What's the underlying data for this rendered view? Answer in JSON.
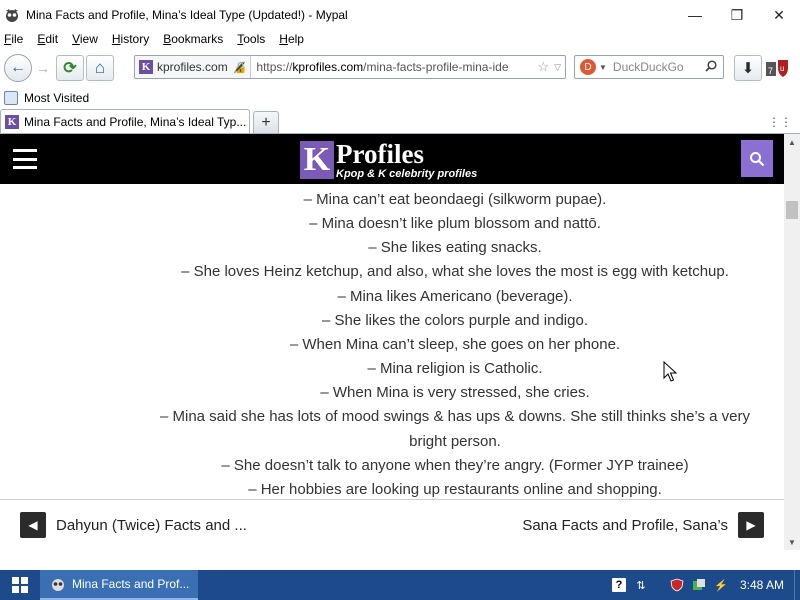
{
  "window": {
    "title": "Mina Facts and Profile, Mina’s Ideal Type (Updated!) - Mypal",
    "minimize": "—",
    "maximize": "❐",
    "close": "✕"
  },
  "menu": {
    "items": [
      "File",
      "Edit",
      "View",
      "History",
      "Bookmarks",
      "Tools",
      "Help"
    ]
  },
  "toolbar": {
    "back": "←",
    "forward": "→",
    "reload": "⟳",
    "home": "⌂",
    "identity_domain": "kprofiles.com",
    "url_prefix": "https://",
    "url_host": "kprofiles.com",
    "url_path": "/mina-facts-profile-mina-ide",
    "search_placeholder": "DuckDuckGo",
    "download": "⬇"
  },
  "bookmarks": {
    "items": [
      "Most Visited"
    ]
  },
  "tabs": {
    "active_title": "Mina Facts and Profile, Mina’s Ideal Typ...",
    "new_tab": "+"
  },
  "site": {
    "logo_letter": "K",
    "logo_name": "Profiles",
    "logo_tagline": "Kpop & K celebrity profiles"
  },
  "facts": [
    "– Mina can’t eat beondaegi (silkworm pupae).",
    "– Mina doesn’t like plum blossom and nattō.",
    "– She likes eating snacks.",
    "– She loves Heinz ketchup, and also, what she loves the most is egg with ketchup.",
    "– Mina likes Americano (beverage).",
    "– She likes the colors purple and indigo.",
    "– When Mina can’t sleep, she goes on her phone.",
    "– Mina religion is Catholic.",
    "– When Mina is very stressed, she cries.",
    "– Mina said she has lots of mood swings & has ups & downs. She still thinks she’s a very bright person.",
    "– She doesn’t talk to anyone when they’re angry. (Former JYP trainee)",
    "– Her hobbies are looking up restaurants online and shopping."
  ],
  "post_nav": {
    "prev_label": "Dahyun (Twice) Facts and ...",
    "next_label": "Sana Facts and Profile, Sana’s",
    "prev_arrow": "◀",
    "next_arrow": "▶"
  },
  "taskbar": {
    "task_label": "Mina Facts and Prof...",
    "clock": "3:48 AM"
  },
  "colors": {
    "site_header": "#000000",
    "brand_purple": "#7a5cb8",
    "search_accent": "#8c6fd2",
    "taskbar": "#1d4a8a"
  }
}
